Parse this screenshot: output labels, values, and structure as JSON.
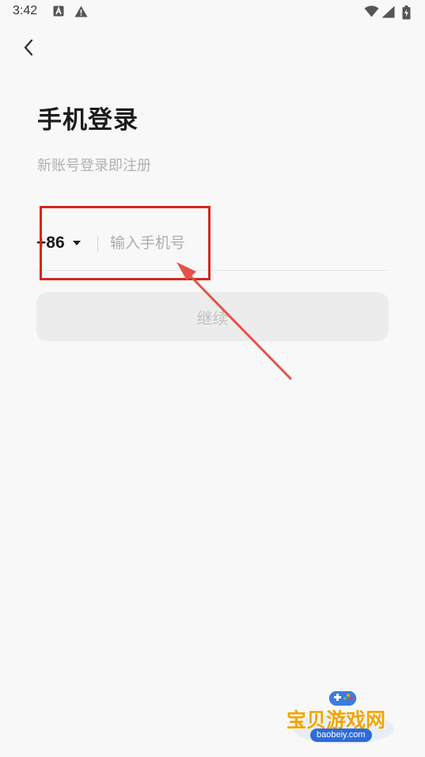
{
  "status_bar": {
    "time": "3:42",
    "icons": [
      "a-notification-icon",
      "warning-icon",
      "wifi-icon",
      "signal-icon",
      "battery-icon"
    ]
  },
  "nav": {
    "back_icon": "chevron-left-icon"
  },
  "login": {
    "title": "手机登录",
    "subtitle": "新账号登录即注册",
    "country_code": "+86",
    "phone_placeholder": "输入手机号",
    "phone_value": "",
    "continue_label": "继续"
  },
  "watermark": {
    "brand": "宝贝游戏网",
    "domain": "baobeiy.com"
  },
  "colors": {
    "background": "#f8f8f8",
    "annotation_red": "#d9251f",
    "button_disabled_bg": "#ececec",
    "button_disabled_text": "#c3c3c3",
    "watermark_orange": "#f3a300",
    "watermark_blue": "#2f6bd8"
  }
}
